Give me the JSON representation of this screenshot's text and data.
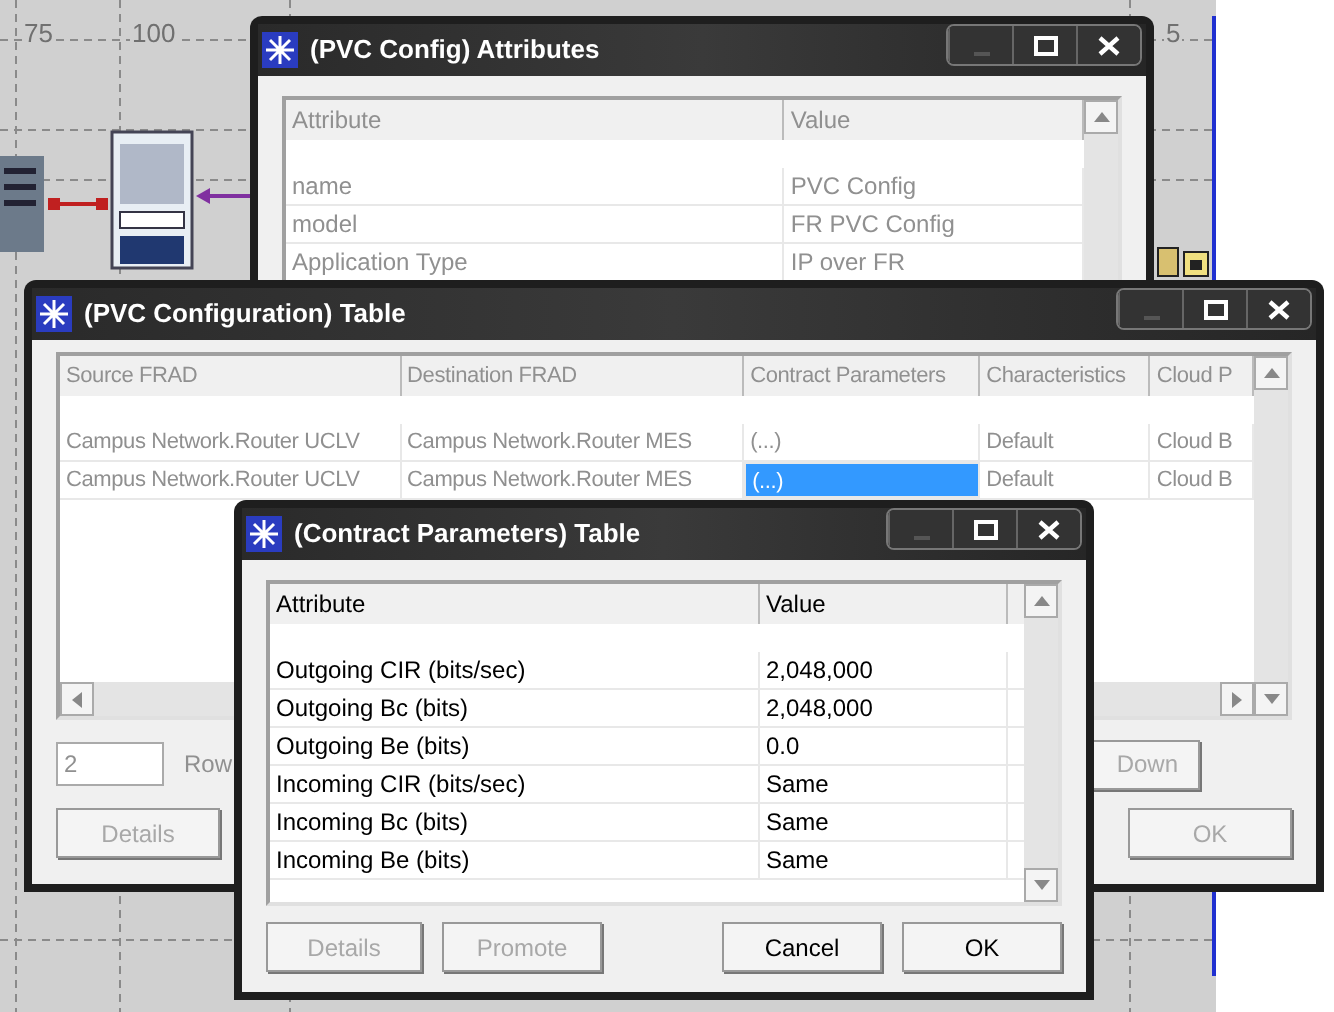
{
  "canvas": {
    "ruler_labels": [
      "75",
      "100",
      "5"
    ]
  },
  "attributes_window": {
    "title": "(PVC Config) Attributes",
    "columns": [
      "Attribute",
      "Value"
    ],
    "rows": [
      {
        "cells": [
          "name",
          "PVC Config"
        ]
      },
      {
        "cells": [
          "model",
          "FR PVC Config"
        ]
      },
      {
        "cells": [
          "Application Type",
          "IP over FR"
        ]
      }
    ]
  },
  "pvc_table_window": {
    "title": "(PVC Configuration) Table",
    "columns": [
      "Source FRAD",
      "Destination FRAD",
      "Contract Parameters",
      "Characteristics",
      "Cloud P"
    ],
    "rows": [
      {
        "cells": [
          {
            "text": "Campus Network.Router UCLV",
            "selected": false
          },
          {
            "text": "Campus Network.Router MES",
            "selected": false
          },
          {
            "text": "(...)",
            "selected": false
          },
          {
            "text": "Default",
            "selected": false
          },
          {
            "text": "Cloud B",
            "selected": false
          }
        ]
      },
      {
        "cells": [
          {
            "text": "Campus Network.Router UCLV",
            "selected": false
          },
          {
            "text": "Campus Network.Router MES",
            "selected": false
          },
          {
            "text": "(...)",
            "selected": true
          },
          {
            "text": "Default",
            "selected": false
          },
          {
            "text": "Cloud B",
            "selected": false
          }
        ]
      }
    ],
    "row_count": {
      "value": "2",
      "label": "Row"
    },
    "buttons": [
      {
        "label": "Details",
        "disabled": true
      },
      {
        "label": "Down",
        "disabled": true
      },
      {
        "label": "OK",
        "disabled": true
      }
    ]
  },
  "contract_window": {
    "title": "(Contract Parameters) Table",
    "columns": [
      "Attribute",
      "Value"
    ],
    "rows": [
      {
        "cells": [
          "Outgoing CIR (bits/sec)",
          "2,048,000"
        ]
      },
      {
        "cells": [
          "Outgoing Bc (bits)",
          "2,048,000"
        ]
      },
      {
        "cells": [
          "Outgoing Be (bits)",
          "0.0"
        ]
      },
      {
        "cells": [
          "Incoming CIR (bits/sec)",
          "Same"
        ]
      },
      {
        "cells": [
          "Incoming Bc (bits)",
          "Same"
        ]
      },
      {
        "cells": [
          "Incoming Be (bits)",
          "Same"
        ]
      }
    ],
    "buttons": [
      {
        "label": "Details",
        "disabled": true
      },
      {
        "label": "Promote",
        "disabled": true
      },
      {
        "label": "Cancel",
        "disabled": false
      },
      {
        "label": "OK",
        "disabled": false
      }
    ]
  }
}
